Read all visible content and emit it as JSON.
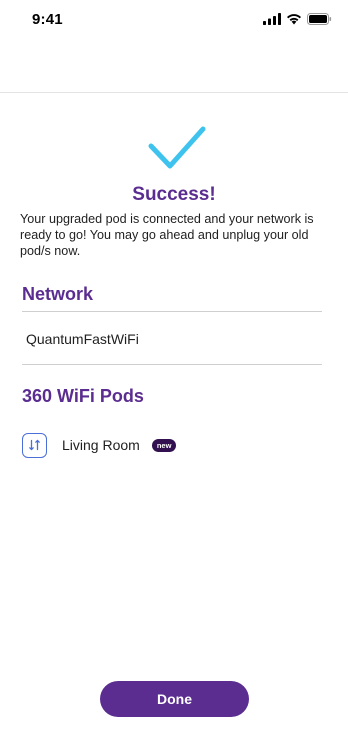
{
  "status_bar": {
    "time": "9:41",
    "icons": [
      "signal-icon",
      "wifi-icon",
      "battery-icon"
    ]
  },
  "success": {
    "icon": "checkmark-icon",
    "title": "Success!",
    "message": "Your upgraded pod is connected and your network is ready to go! You may go ahead and unplug your old pod/s now."
  },
  "network": {
    "title": "Network",
    "name": "QuantumFastWiFi"
  },
  "pods": {
    "title": "360 WiFi Pods",
    "items": [
      {
        "icon": "pod-icon",
        "label": "Living Room",
        "badge": "new"
      }
    ]
  },
  "actions": {
    "done_label": "Done"
  },
  "colors": {
    "accent": "#5b2d90",
    "check": "#3ec3ef",
    "badge_bg": "#33104f",
    "pod_icon": "#4a6fd9"
  }
}
